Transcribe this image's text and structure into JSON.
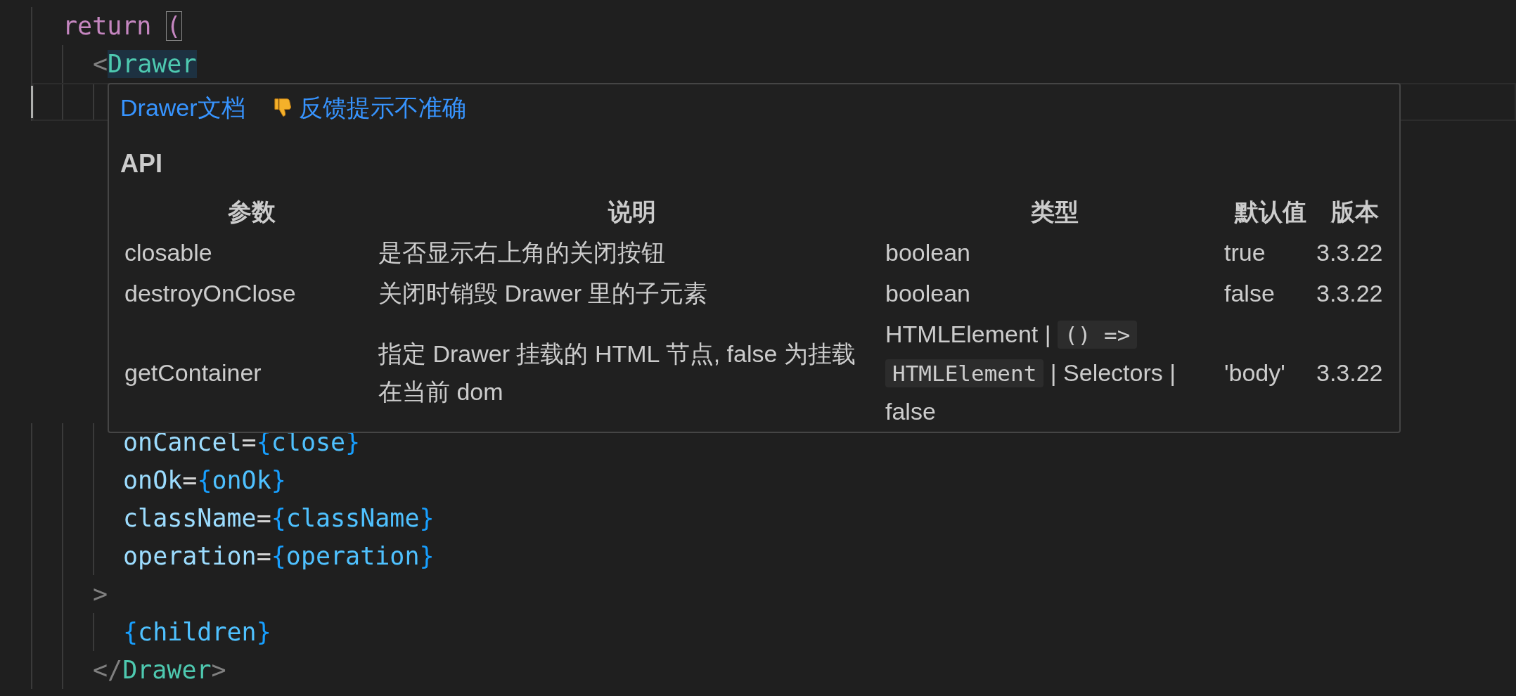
{
  "editor": {
    "lines": [
      {
        "current": false,
        "tokens": [
          {
            "kind": "keyword",
            "text": "return "
          },
          {
            "kind": "bracket",
            "text": "("
          }
        ],
        "children": [
          {
            "current": false,
            "tokens": [
              {
                "kind": "punct",
                "text": "<"
              },
              {
                "kind": "tag_highlight",
                "text": "Drawer"
              }
            ],
            "children": [
              {
                "current": true,
                "hover": {
                  "links": [
                    {
                      "kind": "doc",
                      "text": "Drawer文档"
                    },
                    {
                      "kind": "feedback",
                      "text": "反馈提示不准确"
                    }
                  ],
                  "heading": "API",
                  "table": {
                    "columns": [
                      "参数",
                      "说明",
                      "类型",
                      "默认值",
                      "版本"
                    ],
                    "rows": [
                      {
                        "cells": [
                          [
                            {
                              "kind": "text",
                              "text": "closable"
                            }
                          ],
                          [
                            {
                              "kind": "text",
                              "text": "是否显示右上角的关闭按钮"
                            }
                          ],
                          [
                            {
                              "kind": "text",
                              "text": "boolean"
                            }
                          ],
                          [
                            {
                              "kind": "text",
                              "text": "true"
                            }
                          ],
                          [
                            {
                              "kind": "text",
                              "text": "3.3.22"
                            }
                          ]
                        ]
                      },
                      {
                        "cells": [
                          [
                            {
                              "kind": "text",
                              "text": "destroyOnClose"
                            }
                          ],
                          [
                            {
                              "kind": "text",
                              "text": "关闭时销毁 Drawer 里的子元素"
                            }
                          ],
                          [
                            {
                              "kind": "text",
                              "text": "boolean"
                            }
                          ],
                          [
                            {
                              "kind": "text",
                              "text": "false"
                            }
                          ],
                          [
                            {
                              "kind": "text",
                              "text": "3.3.22"
                            }
                          ]
                        ]
                      },
                      {
                        "cells": [
                          [
                            {
                              "kind": "text",
                              "text": "getContainer"
                            }
                          ],
                          [
                            {
                              "kind": "text",
                              "text": "指定 Drawer 挂载的 HTML 节点, false 为挂载在当前 dom"
                            }
                          ],
                          [
                            {
                              "kind": "text",
                              "text": "HTMLElement |"
                            },
                            {
                              "kind": "code",
                              "text": "() =>"
                            },
                            {
                              "kind": "code",
                              "text": "HTMLElement"
                            },
                            {
                              "kind": "text",
                              "text": "| Selectors |"
                            },
                            {
                              "kind": "text",
                              "text": "false"
                            }
                          ],
                          [
                            {
                              "kind": "text",
                              "text": "'body'"
                            }
                          ],
                          [
                            {
                              "kind": "text",
                              "text": "3.3.22"
                            }
                          ]
                        ]
                      }
                    ]
                  }
                }
              },
              {
                "current": false,
                "tokens": [
                  {
                    "kind": "attr",
                    "text": "onCancel"
                  },
                  {
                    "kind": "operator",
                    "text": "="
                  },
                  {
                    "kind": "brace",
                    "text": "{"
                  },
                  {
                    "kind": "var",
                    "text": "close"
                  },
                  {
                    "kind": "brace",
                    "text": "}"
                  }
                ]
              },
              {
                "current": false,
                "tokens": [
                  {
                    "kind": "attr",
                    "text": "onOk"
                  },
                  {
                    "kind": "operator",
                    "text": "="
                  },
                  {
                    "kind": "brace",
                    "text": "{"
                  },
                  {
                    "kind": "var",
                    "text": "onOk"
                  },
                  {
                    "kind": "brace",
                    "text": "}"
                  }
                ]
              },
              {
                "current": false,
                "tokens": [
                  {
                    "kind": "attr",
                    "text": "className"
                  },
                  {
                    "kind": "operator",
                    "text": "="
                  },
                  {
                    "kind": "brace",
                    "text": "{"
                  },
                  {
                    "kind": "var",
                    "text": "className"
                  },
                  {
                    "kind": "brace",
                    "text": "}"
                  }
                ]
              },
              {
                "current": false,
                "tokens": [
                  {
                    "kind": "attr",
                    "text": "operation"
                  },
                  {
                    "kind": "operator",
                    "text": "="
                  },
                  {
                    "kind": "brace",
                    "text": "{"
                  },
                  {
                    "kind": "var",
                    "text": "operation"
                  },
                  {
                    "kind": "brace",
                    "text": "}"
                  }
                ]
              }
            ]
          },
          {
            "current": false,
            "tokens": [
              {
                "kind": "punct",
                "text": ">"
              }
            ],
            "children": [
              {
                "current": false,
                "tokens": [
                  {
                    "kind": "brace",
                    "text": "{"
                  },
                  {
                    "kind": "var",
                    "text": "children"
                  },
                  {
                    "kind": "brace",
                    "text": "}"
                  }
                ]
              }
            ]
          },
          {
            "current": false,
            "tokens": [
              {
                "kind": "punct",
                "text": "</"
              },
              {
                "kind": "tag",
                "text": "Drawer"
              },
              {
                "kind": "punct",
                "text": ">"
              }
            ]
          }
        ]
      }
    ]
  }
}
